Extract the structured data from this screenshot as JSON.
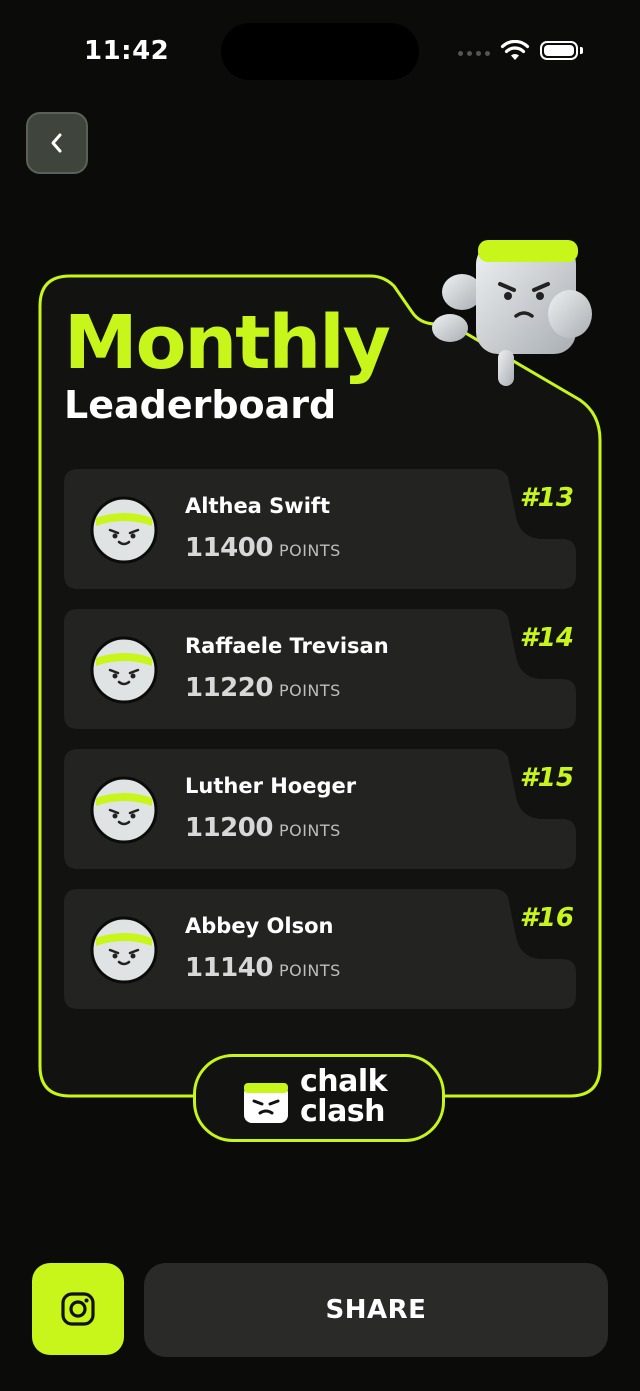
{
  "status_bar": {
    "time": "11:42"
  },
  "header": {
    "back_icon": "chevron-left-icon"
  },
  "title": {
    "line1": "Monthly",
    "line2": "Leaderboard"
  },
  "leaderboard": {
    "points_unit": "POINTS",
    "entries": [
      {
        "name": "Althea Swift",
        "points": "11400",
        "rank": "#13"
      },
      {
        "name": "Raffaele Trevisan",
        "points": "11220",
        "rank": "#14"
      },
      {
        "name": "Luther Hoeger",
        "points": "11200",
        "rank": "#15"
      },
      {
        "name": "Abbey Olson",
        "points": "11140",
        "rank": "#16"
      }
    ]
  },
  "logo": {
    "line1": "chalk",
    "line2": "clash"
  },
  "actions": {
    "instagram_icon": "instagram-icon",
    "share_label": "SHARE"
  },
  "colors": {
    "accent": "#c8f51a",
    "background": "#0b0c09",
    "card": "#121310",
    "row": "#232421",
    "button": "#2a2b29"
  }
}
